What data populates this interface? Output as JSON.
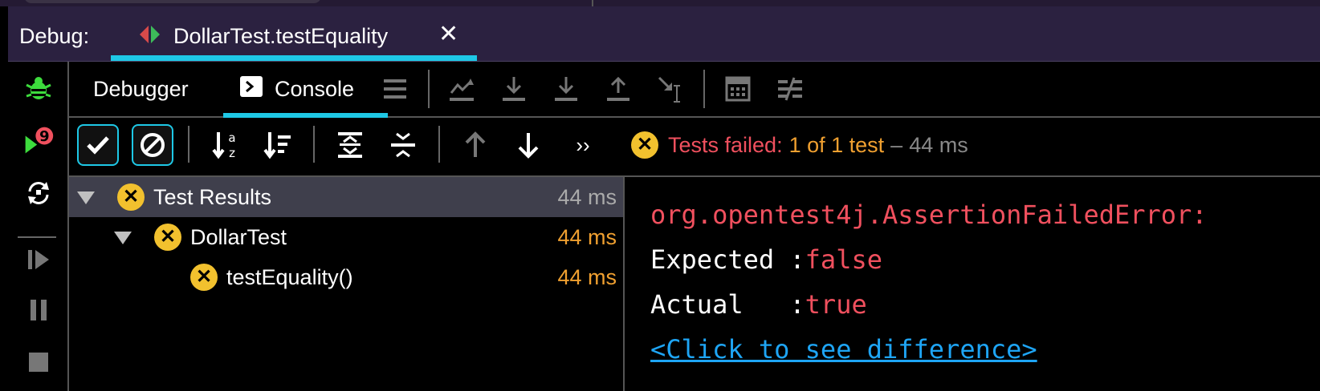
{
  "debug_bar": {
    "label": "Debug:",
    "run_tab": {
      "title": "DollarTest.testEquality",
      "close_glyph": "✕"
    }
  },
  "tabs": [
    {
      "label": "Debugger",
      "active": false
    },
    {
      "label": "Console",
      "active": true
    }
  ],
  "left_toolbar_badge": "9",
  "status": {
    "prefix": "Tests failed:",
    "count": "1 of 1 test",
    "dash": "–",
    "time": "44 ms"
  },
  "tree": [
    {
      "label": "Test Results",
      "time": "44 ms",
      "selected": true
    },
    {
      "label": "DollarTest",
      "time": "44 ms",
      "selected": false
    },
    {
      "label": "testEquality()",
      "time": "44 ms",
      "selected": false
    }
  ],
  "console": {
    "error": "org.opentest4j.AssertionFailedError:",
    "expected_key": "Expected :",
    "expected_val": "false",
    "actual_key": "Actual   :",
    "actual_val": "true",
    "link": "<Click to see difference>"
  },
  "colors": {
    "accent": "#1ec8e6",
    "error_red": "#f0505e",
    "warn_orange": "#f0a030",
    "fail_badge": "#f2c12e",
    "link_blue": "#1ea5f5",
    "debug_green": "#3ddc3d"
  }
}
